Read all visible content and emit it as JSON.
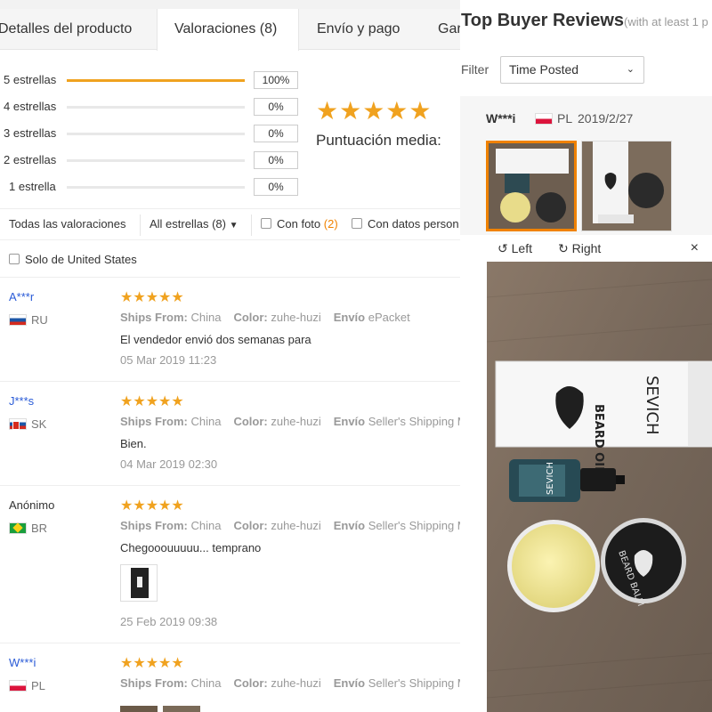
{
  "tabs": [
    {
      "label": "Detalles del producto"
    },
    {
      "label": "Valoraciones (8)"
    },
    {
      "label": "Envío y pago"
    },
    {
      "label": "Gar"
    }
  ],
  "histogram": [
    {
      "label": "5 estrellas",
      "pct": "100%",
      "fill": 1.0
    },
    {
      "label": "4 estrellas",
      "pct": "0%",
      "fill": 0
    },
    {
      "label": "3 estrellas",
      "pct": "0%",
      "fill": 0
    },
    {
      "label": "2 estrellas",
      "pct": "0%",
      "fill": 0
    },
    {
      "label": "1 estrella",
      "pct": "0%",
      "fill": 0
    }
  ],
  "summary": {
    "stars": "★★★★★",
    "avg_label": "Puntuación media:"
  },
  "filters": {
    "all": "Todas las valoraciones",
    "stars_select": "All estrellas (8)",
    "with_photo": "Con foto",
    "with_photo_count": "(2)",
    "with_personal": "Con datos person",
    "only_us": "Solo de United States"
  },
  "reviews": [
    {
      "name": "A***r",
      "country": "RU",
      "flag": "ru",
      "stars": "★★★★★",
      "ships_from_label": "Ships From:",
      "ships_from": "China",
      "color_label": "Color:",
      "color": "zuhe-huzi",
      "envio_label": "Envío",
      "envio": "ePacket",
      "text": "El vendedor envió dos semanas para",
      "date": "05 Mar 2019 11:23"
    },
    {
      "name": "J***s",
      "country": "SK",
      "flag": "sk",
      "stars": "★★★★★",
      "ships_from_label": "Ships From:",
      "ships_from": "China",
      "color_label": "Color:",
      "color": "zuhe-huzi",
      "envio_label": "Envío",
      "envio": "Seller's Shipping M",
      "text": "Bien.",
      "date": "04 Mar 2019 02:30"
    },
    {
      "name": "Anónimo",
      "country": "BR",
      "flag": "br",
      "stars": "★★★★★",
      "ships_from_label": "Ships From:",
      "ships_from": "China",
      "color_label": "Color:",
      "color": "zuhe-huzi",
      "envio_label": "Envío",
      "envio": "Seller's Shipping M",
      "text": "Chegooouuuuu... temprano",
      "date": "25 Feb 2019 09:38"
    },
    {
      "name": "W***i",
      "country": "PL",
      "flag": "pl",
      "stars": "★★★★★",
      "ships_from_label": "Ships From:",
      "ships_from": "China",
      "color_label": "Color:",
      "color": "zuhe-huzi",
      "envio_label": "Envío",
      "envio": "Seller's Shipping M",
      "text": "",
      "date": ""
    }
  ],
  "top_reviews": {
    "title": "Top Buyer Reviews",
    "subtitle": "(with at least 1 p",
    "filter_label": "Filter",
    "filter_value": "Time Posted",
    "user": "W***i",
    "country": "PL",
    "date": "2019/2/27",
    "rotate_left": "Left",
    "rotate_right": "Right",
    "close": "×"
  },
  "product_print": {
    "brand": "SEVICH",
    "box_label": "BEARD OIL",
    "balm_label": "BEARD BALM"
  },
  "colors": {
    "accent": "#f0a21f",
    "link": "#2a5bd7",
    "selected_border": "#f08200"
  }
}
